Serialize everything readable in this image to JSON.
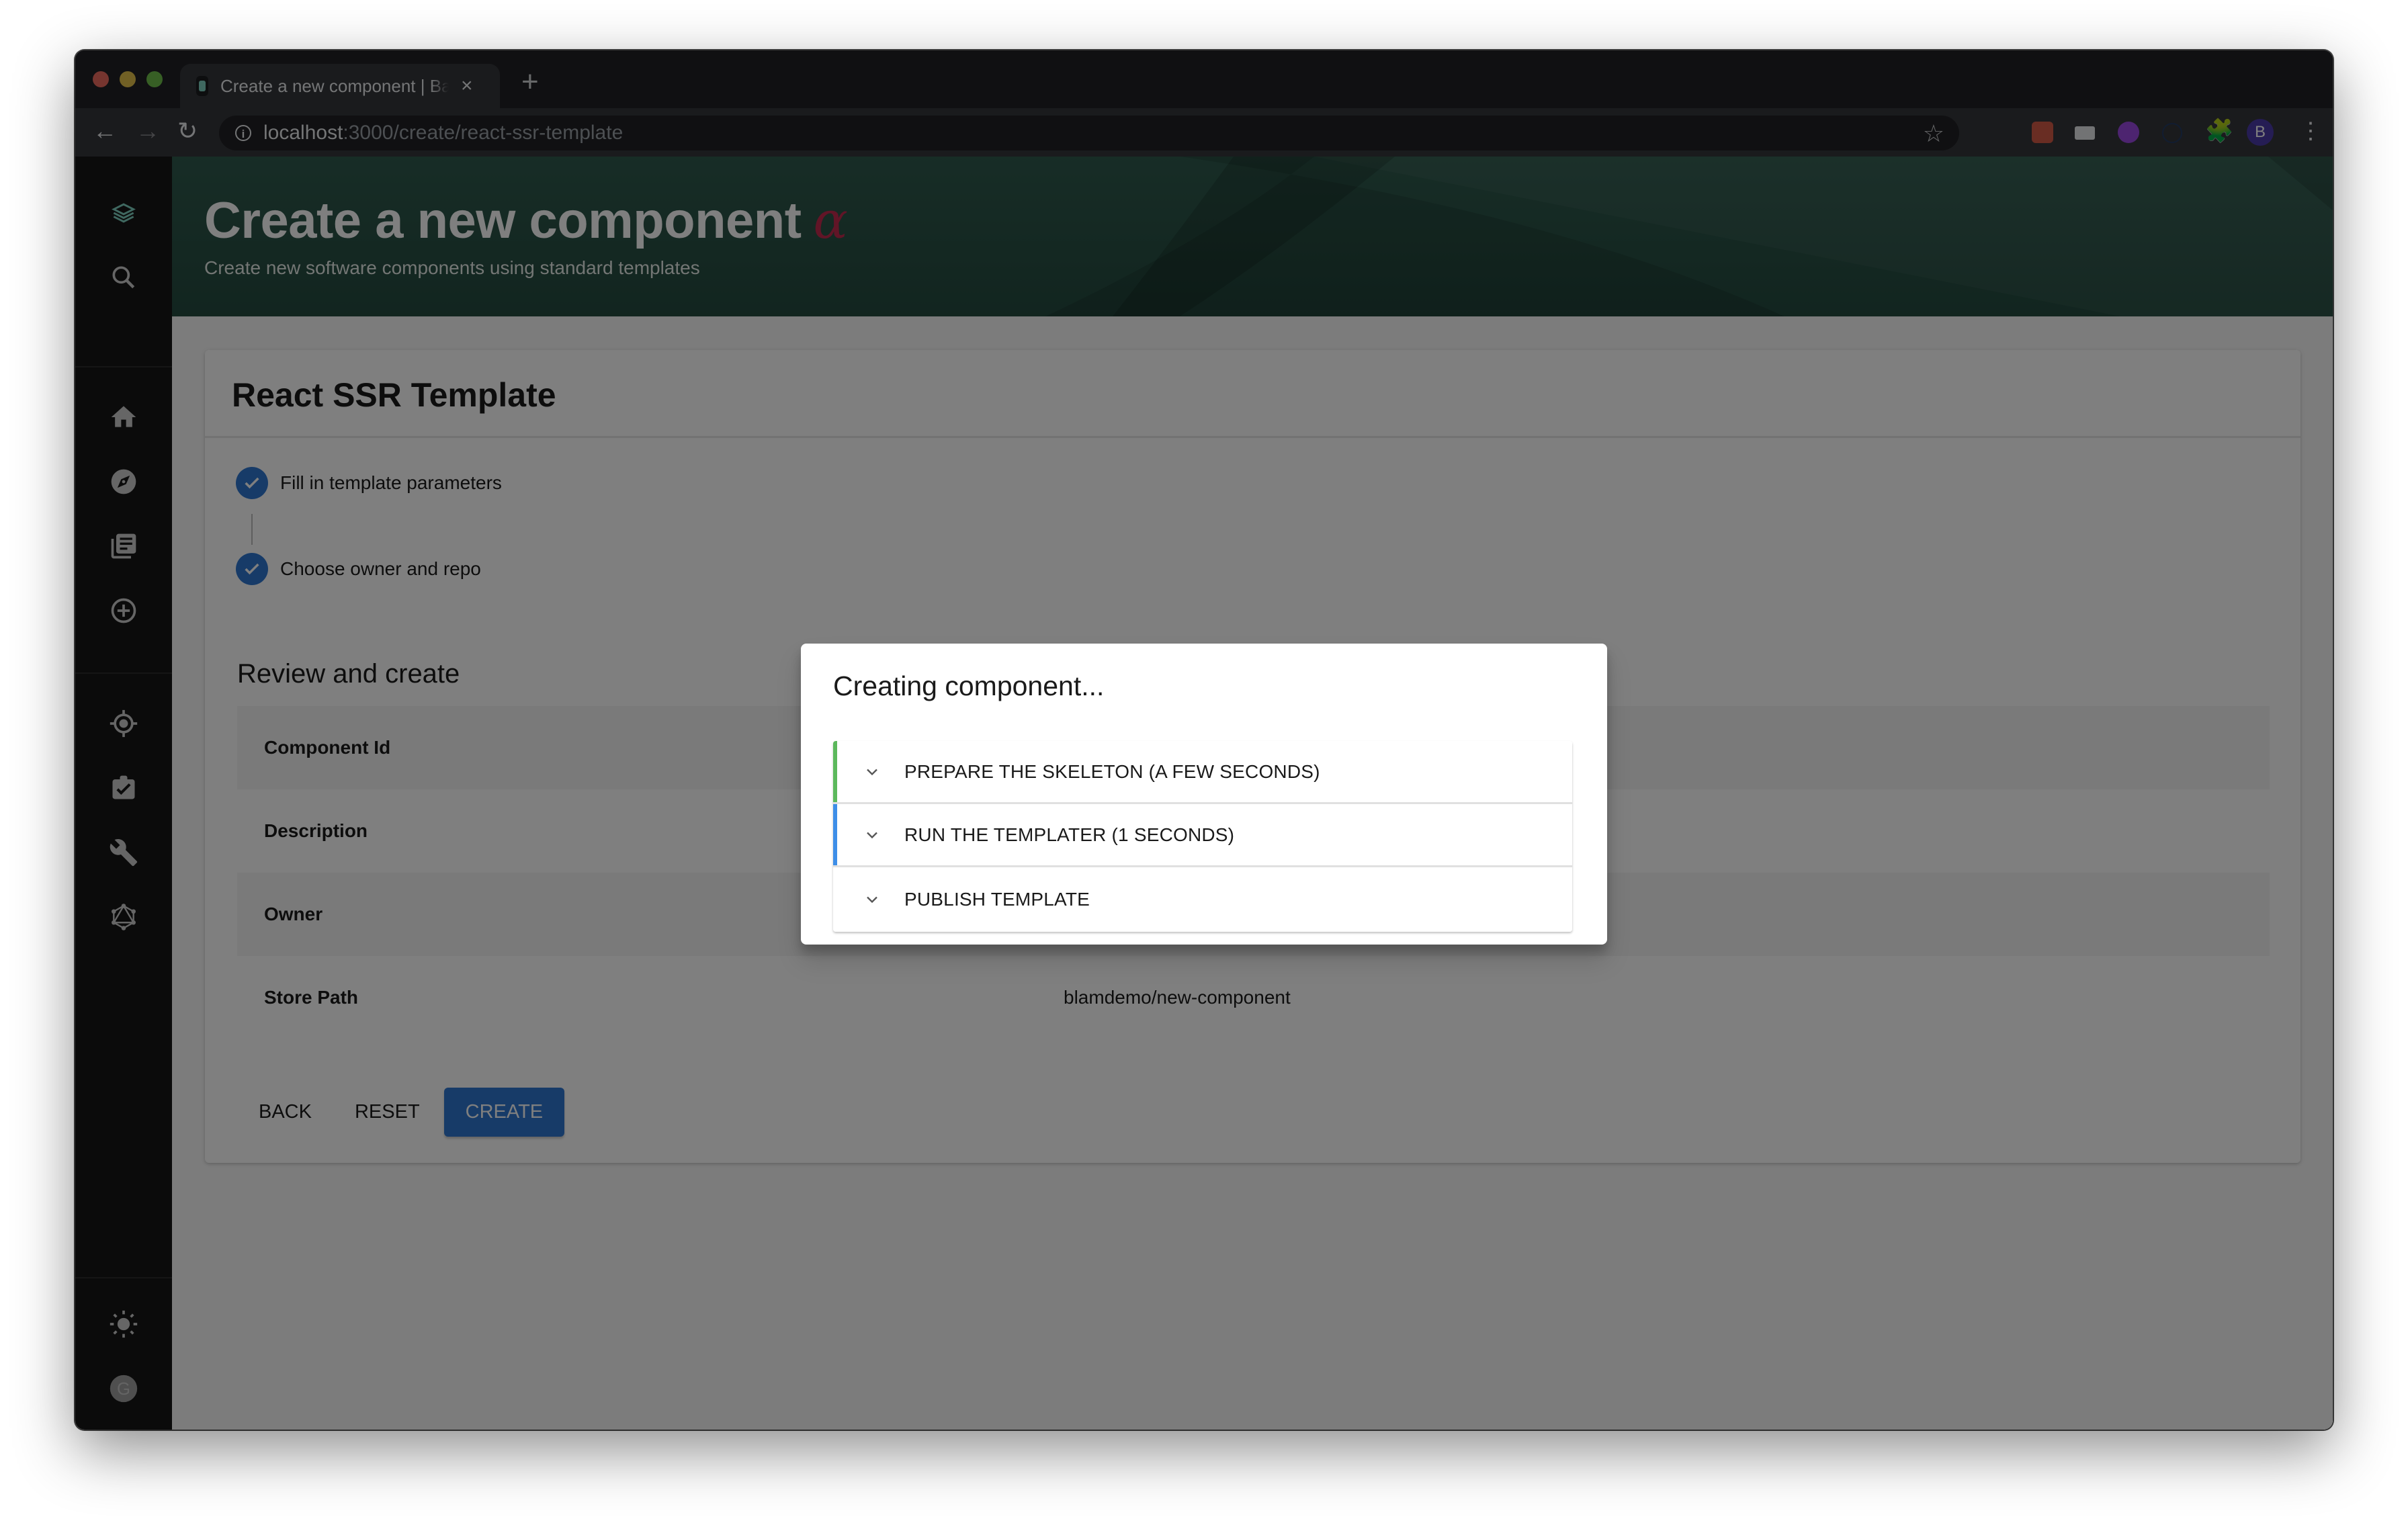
{
  "browser": {
    "tab_title": "Create a new component | Backstage",
    "tab_close": "×",
    "new_tab": "+",
    "url_host": "localhost",
    "url_path": ":3000/create/react-ssr-template",
    "profile_initial": "B",
    "extensions": [
      "react-devtools-icon",
      "password-manager-icon",
      "purple-extension-icon",
      "a-extension-icon",
      "extensions-puzzle-icon"
    ]
  },
  "sidebar": {
    "items": [
      {
        "name": "backstage-logo"
      },
      {
        "name": "search"
      },
      {
        "name": "home"
      },
      {
        "name": "explore"
      },
      {
        "name": "docs"
      },
      {
        "name": "create"
      },
      {
        "name": "tech-radar"
      },
      {
        "name": "lighthouse"
      },
      {
        "name": "tools"
      },
      {
        "name": "graphiql"
      },
      {
        "name": "theme-toggle"
      },
      {
        "name": "user-avatar",
        "initial": "G"
      }
    ]
  },
  "header": {
    "title": "Create a new component",
    "alpha": "α",
    "subtitle": "Create new software components using standard templates"
  },
  "card": {
    "title": "React SSR Template",
    "steps": [
      {
        "label": "Fill in template parameters",
        "status": "completed"
      },
      {
        "label": "Choose owner and repo",
        "status": "completed"
      }
    ],
    "review_title": "Review and create",
    "review_rows": [
      {
        "key": "Component Id",
        "value": ""
      },
      {
        "key": "Description",
        "value": ""
      },
      {
        "key": "Owner",
        "value": ""
      },
      {
        "key": "Store Path",
        "value": "blamdemo/new-component"
      }
    ],
    "buttons": {
      "back": "Back",
      "reset": "Reset",
      "create": "Create"
    }
  },
  "modal": {
    "title": "Creating component...",
    "tasks": [
      {
        "label": "PREPARE THE SKELETON (A FEW SECONDS)",
        "status": "completed",
        "color": "#5cb85c"
      },
      {
        "label": "RUN THE TEMPLATER (1 SECONDS)",
        "status": "in-progress",
        "color": "#3d8ee8"
      },
      {
        "label": "PUBLISH TEMPLATE",
        "status": "pending",
        "color": "#ffffff"
      }
    ]
  },
  "colors": {
    "accent": "#2e77d0",
    "header_green": "#2f5a4d",
    "sidebar": "#171717",
    "alpha": "#c22a4e"
  }
}
